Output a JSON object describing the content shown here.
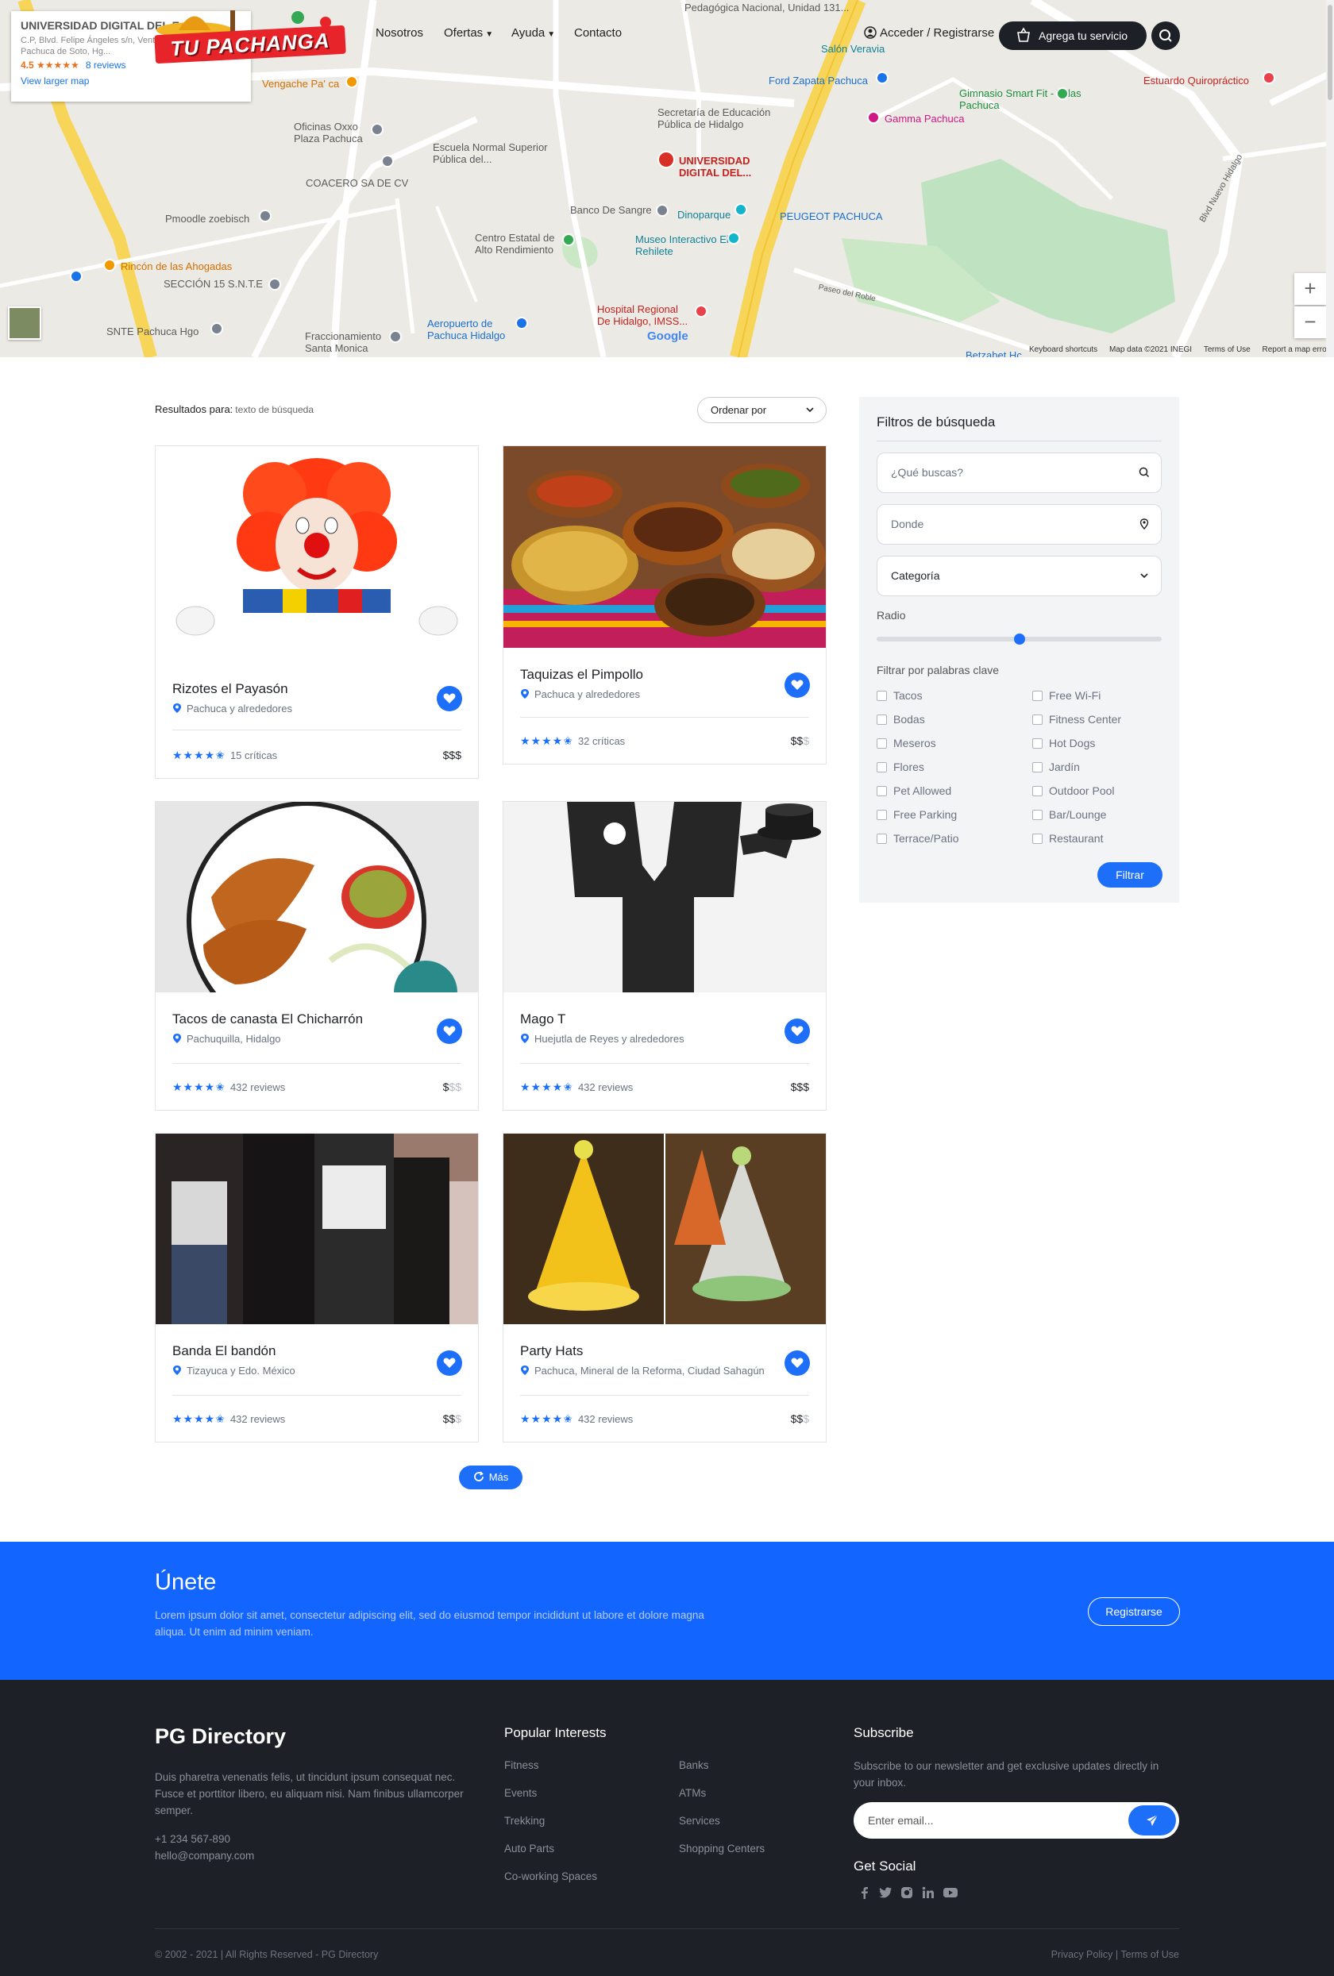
{
  "map": {
    "info_title": "UNIVERSIDAD DIGITAL DEL E...",
    "info_address": "C.P, Blvd. Felipe Ángeles s/n, Venta Prieta, 42083 Pachuca de Soto, Hg...",
    "info_rating": "4.5 ★★★★★",
    "info_reviews": "8 reviews",
    "info_link": "View larger map",
    "labels": {
      "pachuca_campus": "Pedagógica Nacional, Unidad 131...",
      "salon": "Salón Veravia",
      "ford": "Ford Zapata Pachuca",
      "estuardo": "Estuardo Quiropráctico",
      "gimnasio": "Gimnasio Smart Fit - Villas Pachuca",
      "gamma": "Gamma Pachuca",
      "secretaria": "Secretaría de Educación Pública de Hidalgo",
      "vengache": "Vengache Pa' ca",
      "oficinas": "Oficinas Oxxo Plaza Pachuca",
      "escuela": "Escuela Normal Superior Pública del...",
      "universidad": "UNIVERSIDAD DIGITAL DEL...",
      "coacero": "COACERO SA DE CV",
      "banco": "Banco De Sangre",
      "dinoparque": "Dinoparque",
      "peugeot": "PEUGEOT PACHUCA",
      "pmoodle": "Pmoodle zoebisch",
      "centro": "Centro Estatal de Alto Rendimiento",
      "museo": "Museo Interactivo El Rehilete",
      "rincon": "Rincón de las Ahogadas",
      "seccion": "SECCIÓN 15 S.N.T.E",
      "hospital": "Hospital Regional De Hidalgo, IMSS...",
      "snte": "SNTE Pachuca Hgo",
      "fraccionamiento": "Fraccionamiento Santa Monica",
      "aeropuerto": "Aeropuerto de Pachuca Hidalgo",
      "paseo_roble": "Paseo del Roble",
      "blvd": "Blvd Nuevo Hidalgo",
      "betzabet": "Betzabet Hc"
    },
    "google": "Google",
    "footer": [
      "Keyboard shortcuts",
      "Map data ©2021 INEGI",
      "Terms of Use",
      "Report a map error"
    ],
    "zoom_in": "+",
    "zoom_out": "−"
  },
  "header": {
    "logo_text": "TU PACHANGA",
    "nav": [
      "Nosotros",
      "Ofertas",
      "Ayuda",
      "Contacto"
    ],
    "login": "Acceder / Registrarse",
    "cta": "Agrega tu servicio"
  },
  "results": {
    "label": "Resultados para:",
    "query": "texto de búsqueda",
    "sort_label": "Ordenar por"
  },
  "cards": [
    {
      "title": "Rizotes el Payasón",
      "location": "Pachuca y alrededores",
      "reviews": "15 críticas",
      "price_on": "$$$",
      "price_off": "",
      "rating": 4.5
    },
    {
      "title": "Taquizas el Pimpollo",
      "location": "Pachuca y alrededores",
      "reviews": "32 críticas",
      "price_on": "$$",
      "price_off": "$",
      "rating": 4.5
    },
    {
      "title": "Tacos de canasta El Chicharrón",
      "location": "Pachuquilla, Hidalgo",
      "reviews": "432 reviews",
      "price_on": "$",
      "price_off": "$$",
      "rating": 4.5
    },
    {
      "title": "Mago T",
      "location": "Huejutla de Reyes y alrededores",
      "reviews": "432 reviews",
      "price_on": "$$$",
      "price_off": "",
      "rating": 4.5
    },
    {
      "title": "Banda El bandón",
      "location": "Tizayuca y Edo. México",
      "reviews": "432 reviews",
      "price_on": "$$",
      "price_off": "$",
      "rating": 4.5
    },
    {
      "title": "Party Hats",
      "location": "Pachuca, Mineral de la Reforma, Ciudad Sahagún",
      "reviews": "432 reviews",
      "price_on": "$$",
      "price_off": "$",
      "rating": 4.5
    }
  ],
  "more_label": "Más",
  "filters": {
    "title": "Filtros de búsqueda",
    "what_placeholder": "¿Qué buscas?",
    "where_placeholder": "Donde",
    "category": "Categoría",
    "radius_label": "Radio",
    "radius_value": 0.5,
    "keywords_label": "Filtrar por palabras clave",
    "keywords_left": [
      "Tacos",
      "Bodas",
      "Meseros",
      "Flores",
      "Pet Allowed",
      "Free Parking",
      "Terrace/Patio"
    ],
    "keywords_right": [
      "Free Wi-Fi",
      "Fitness Center",
      "Hot Dogs",
      "Jardín",
      "Outdoor Pool",
      "Bar/Lounge",
      "Restaurant"
    ],
    "submit": "Filtrar"
  },
  "join": {
    "title": "Únete",
    "text": "Lorem ipsum dolor sit amet, consectetur adipiscing elit, sed do eiusmod tempor incididunt ut labore et dolore magna aliqua. Ut enim ad minim veniam.",
    "button": "Registrarse"
  },
  "footer": {
    "brand": "PG Directory",
    "description": "Duis pharetra venenatis felis, ut tincidunt ipsum consequat nec. Fusce et porttitor libero, eu aliquam nisi. Nam finibus ullamcorper semper.",
    "phone": "+1 234 567-890",
    "email": "hello@company.com",
    "interests_title": "Popular Interests",
    "interests_left": [
      "Fitness",
      "Events",
      "Trekking",
      "Auto Parts",
      "Co-working Spaces"
    ],
    "interests_right": [
      "Banks",
      "ATMs",
      "Services",
      "Shopping Centers"
    ],
    "subscribe_title": "Subscribe",
    "subscribe_text": "Subscribe to our newsletter and get exclusive updates directly in your inbox.",
    "email_placeholder": "Enter email...",
    "social_title": "Get Social",
    "social_icons": [
      "facebook-icon",
      "twitter-icon",
      "instagram-icon",
      "linkedin-icon",
      "youtube-icon"
    ],
    "copyright": "© 2002 - 2021 | All Rights Reserved - PG Directory",
    "legal": "Privacy Policy | Terms of Use"
  },
  "colors": {
    "accent": "#1d6ffa",
    "banner": "#1265ff",
    "footer_bg": "#1d2026",
    "logo_red": "#e8242b"
  }
}
